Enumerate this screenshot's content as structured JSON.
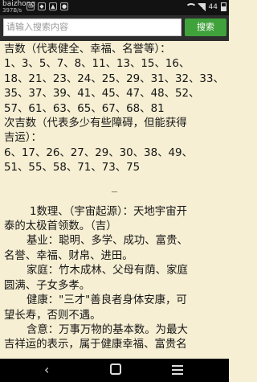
{
  "status": {
    "app": "baizhong",
    "speed": "397B/s",
    "battery": "44"
  },
  "search": {
    "placeholder": "请输入搜索内容",
    "button": "搜索"
  },
  "article": {
    "line1": "吉数（代表健全、幸福、名誉等）：",
    "line2": "1、3、5、7、8、11、13、15、16、",
    "line3": "18、21、23、24、25、29、31、32、33、",
    "line4": "35、37、39、41、45、47、48、52、",
    "line5": "57、61、63、65、67、68、81",
    "line6": "次吉数（代表多少有些障碍，但能获得",
    "line7": "吉运）：",
    "line8": "6、17、26、27、29、30、38、49、",
    "line9": "51、55、58、71、73、75",
    "separator": "—",
    "s1": "1数理、（宇宙起源）：天地宇宙开",
    "s2": "泰的太极首领数。（吉）",
    "s3": "基业：聪明、多学、成功、富贵、",
    "s4": "名誉、幸福、财帛、进田。",
    "s5": "家庭：竹木成林、父母有荫、家庭",
    "s6": "圆满、子女多孝。",
    "s7": "健康：\"三才\"善良者身体安康，可",
    "s8": "望长寿，否则不遇。",
    "s9": "含意：万事万物的基本数。为最大",
    "s10": "吉祥运的表示，属于健康幸福、富贵名"
  },
  "nav": {
    "back": "‹"
  }
}
